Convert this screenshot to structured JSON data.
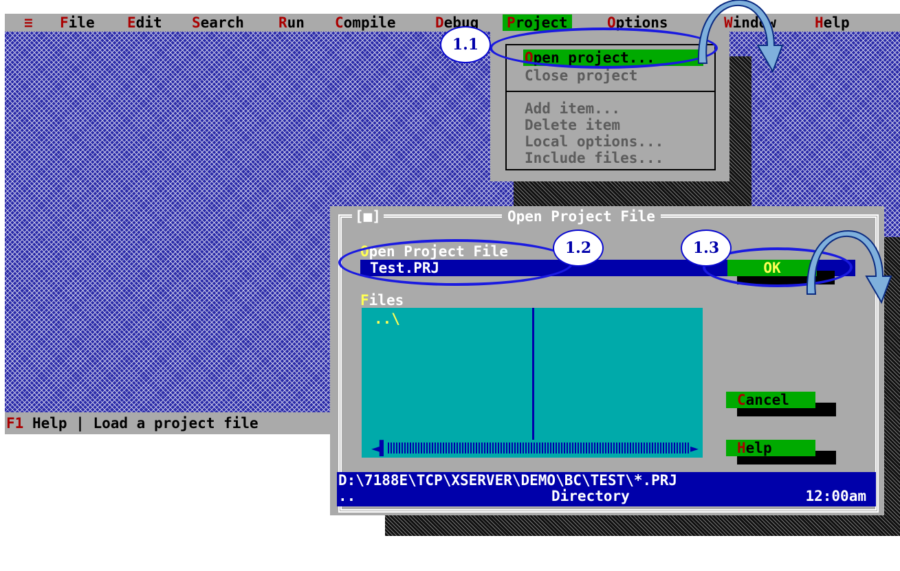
{
  "menubar": {
    "system_icon": "≡",
    "items": [
      {
        "hotkey": "F",
        "rest": "ile"
      },
      {
        "hotkey": "E",
        "rest": "dit"
      },
      {
        "hotkey": "S",
        "rest": "earch"
      },
      {
        "hotkey": "R",
        "rest": "un"
      },
      {
        "hotkey": "C",
        "rest": "ompile"
      },
      {
        "hotkey": "D",
        "rest": "ebug"
      },
      {
        "hotkey": "P",
        "rest": "roject"
      },
      {
        "hotkey": "O",
        "rest": "ptions"
      },
      {
        "hotkey": "W",
        "rest": "indow"
      },
      {
        "hotkey": "H",
        "rest": "elp"
      }
    ]
  },
  "project_menu": {
    "items": [
      {
        "hotkey": "O",
        "rest": "pen project..."
      },
      {
        "label": "Close project"
      },
      {
        "label": "Add item..."
      },
      {
        "label": "Delete item"
      },
      {
        "label": "Local options..."
      },
      {
        "label": "Include files..."
      }
    ]
  },
  "statusbar": {
    "key": "F1",
    "key_label": " Help",
    "separator": " | ",
    "message": "Load a project file"
  },
  "dialog": {
    "close_box": "[■]",
    "title": "Open Project File",
    "filename_label_hotkey": "O",
    "filename_label_rest": "pen Project File",
    "filename_value": "Test.PRJ",
    "files_label_hotkey": "F",
    "files_label_rest": "iles",
    "file_items": [
      "..\\"
    ],
    "buttons": {
      "ok": "OK",
      "cancel_hotkey": "C",
      "cancel_rest": "ancel",
      "help_hotkey": "H",
      "help_rest": "elp"
    },
    "info": {
      "path": "D:\\7188E\\TCP\\XSERVER\\DEMO\\BC\\TEST\\*.PRJ",
      "entry": "..",
      "type": "Directory",
      "time": "12:00am"
    }
  },
  "annotations": {
    "step_1_1": "1.1",
    "step_1_2": "1.2",
    "step_1_3": "1.3"
  },
  "colors": {
    "menu_bg": "#aaaaaa",
    "hotkey": "#aa0000",
    "selection": "#00aa00",
    "desktop": "#2a2aa8",
    "listbox": "#00aaaa",
    "annotation": "#1a1ae0",
    "arrow": "#7fb0dc"
  }
}
